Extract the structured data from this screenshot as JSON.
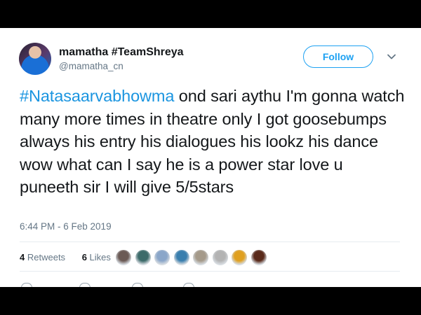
{
  "tweet": {
    "display_name": "mamatha #TeamShreya",
    "handle": "@mamatha_cn",
    "follow_label": "Follow",
    "hashtag": "#Natasaarvabhowma",
    "text_rest": " ond sari aythu I'm gonna watch many more times in theatre only I got goosebumps always his entry his dialogues his lookz his dance wow what can I say he is a power star love u puneeth sir I will give 5/5stars",
    "timestamp": "6:44 PM - 6 Feb 2019",
    "retweets_count": "4",
    "retweets_label": "Retweets",
    "likes_count": "6",
    "likes_label": "Likes"
  },
  "colors": {
    "accent": "#1da1f2",
    "hashtag": "#1b95e0",
    "text": "#14171a",
    "muted": "#657786"
  },
  "likers": [
    {
      "name": "liker-avatar-1",
      "color": "#6b5a55"
    },
    {
      "name": "liker-avatar-2",
      "color": "#3d6b6a"
    },
    {
      "name": "liker-avatar-3",
      "color": "#8aa6c9"
    },
    {
      "name": "liker-avatar-4",
      "color": "#3a7fae"
    },
    {
      "name": "liker-avatar-5",
      "color": "#a59a8a"
    },
    {
      "name": "liker-avatar-6",
      "color": "#b3b3b3"
    },
    {
      "name": "liker-avatar-7",
      "color": "#e0a020"
    },
    {
      "name": "liker-avatar-8",
      "color": "#5a2a1a"
    }
  ],
  "icons": [
    "chevron-down-icon",
    "reply-icon",
    "retweet-icon",
    "like-icon",
    "message-icon"
  ]
}
